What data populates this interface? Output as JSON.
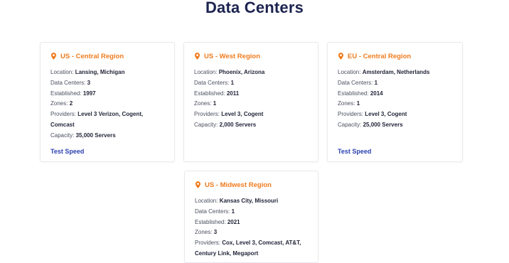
{
  "page": {
    "title": "Data Centers"
  },
  "labels": {
    "location": "Location:",
    "data_centers": "Data Centers:",
    "established": "Established:",
    "zones": "Zones:",
    "providers": "Providers:",
    "capacity": "Capacity:"
  },
  "colors": {
    "accent": "#f07b1d",
    "title": "#1c2350",
    "link": "#2a3fb1"
  },
  "icons": {
    "region": "map-pin-icon"
  },
  "regions": [
    {
      "name": "US - Central Region",
      "location": "Lansing, Michigan",
      "data_centers": "3",
      "established": "1997",
      "zones": "2",
      "providers": "Level 3 Verizon, Cogent, Comcast",
      "capacity": "35,000 Servers",
      "action": "Test Speed"
    },
    {
      "name": "US - West Region",
      "location": "Phoenix, Arizona",
      "data_centers": "1",
      "established": "2011",
      "zones": "1",
      "providers": "Level 3, Cogent",
      "capacity": "2,000 Servers"
    },
    {
      "name": "EU - Central Region",
      "location": "Amsterdam, Netherlands",
      "data_centers": "1",
      "established": "2014",
      "zones": "1",
      "providers": "Level 3, Cogent",
      "capacity": "25,000 Servers",
      "action": "Test Speed"
    },
    {
      "name": "US - Midwest Region",
      "location": "Kansas City, Missouri",
      "data_centers": "1",
      "established": "2021",
      "zones": "3",
      "providers": "Cox, Level 3, Comcast, AT&T, Century Link, Megaport"
    }
  ]
}
